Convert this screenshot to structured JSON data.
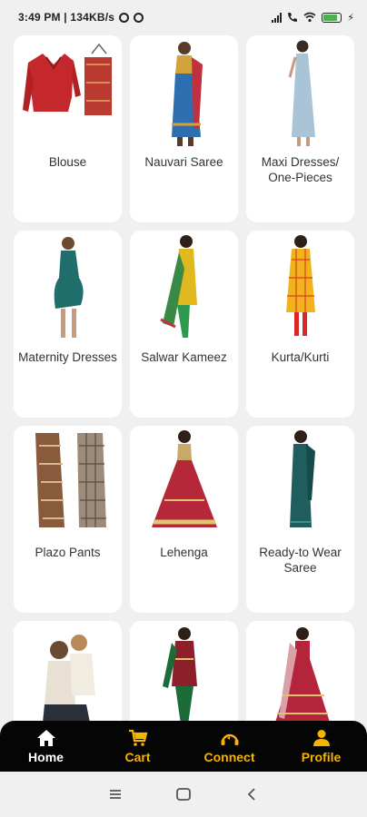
{
  "status_bar": {
    "time_speed": "3:49 PM | 134KB/s",
    "battery_level": 0.8
  },
  "categories": [
    {
      "label": "Blouse",
      "icon": "blouse-image",
      "color": "#c4282c"
    },
    {
      "label": "Nauvari Saree",
      "icon": "nauvari-saree-image",
      "color": "#2d6fb0"
    },
    {
      "label": "Maxi Dresses/ One-Pieces",
      "icon": "maxi-dress-image",
      "color": "#a9c4d6"
    },
    {
      "label": "Maternity Dresses",
      "icon": "maternity-dress-image",
      "color": "#1f6e6b"
    },
    {
      "label": "Salwar Kameez",
      "icon": "salwar-kameez-image",
      "color": "#e0b820"
    },
    {
      "label": "Kurta/Kurti",
      "icon": "kurta-image",
      "color": "#f0b31e"
    },
    {
      "label": "Plazo Pants",
      "icon": "plazo-pants-image",
      "color": "#8a5a3c"
    },
    {
      "label": "Lehenga",
      "icon": "lehenga-image",
      "color": "#b5283a"
    },
    {
      "label": "Ready-to Wear Saree",
      "icon": "ready-saree-image",
      "color": "#1f5d5e"
    },
    {
      "label": "",
      "icon": "kids-wear-image",
      "color": "#e8e0d2"
    },
    {
      "label": "",
      "icon": "girls-suit-image",
      "color": "#8c1f2a"
    },
    {
      "label": "",
      "icon": "bridal-lehenga-image",
      "color": "#b4243a"
    }
  ],
  "bottom_nav": {
    "items": [
      {
        "label": "Home",
        "icon": "home-icon",
        "active": true
      },
      {
        "label": "Cart",
        "icon": "cart-icon",
        "active": false
      },
      {
        "label": "Connect",
        "icon": "connect-icon",
        "active": false
      },
      {
        "label": "Profile",
        "icon": "profile-icon",
        "active": false
      }
    ],
    "active_color": "#ffffff",
    "inactive_color": "#f5b400"
  },
  "system_nav": {
    "icons": [
      "menu-icon",
      "home-square-icon",
      "back-icon"
    ]
  }
}
